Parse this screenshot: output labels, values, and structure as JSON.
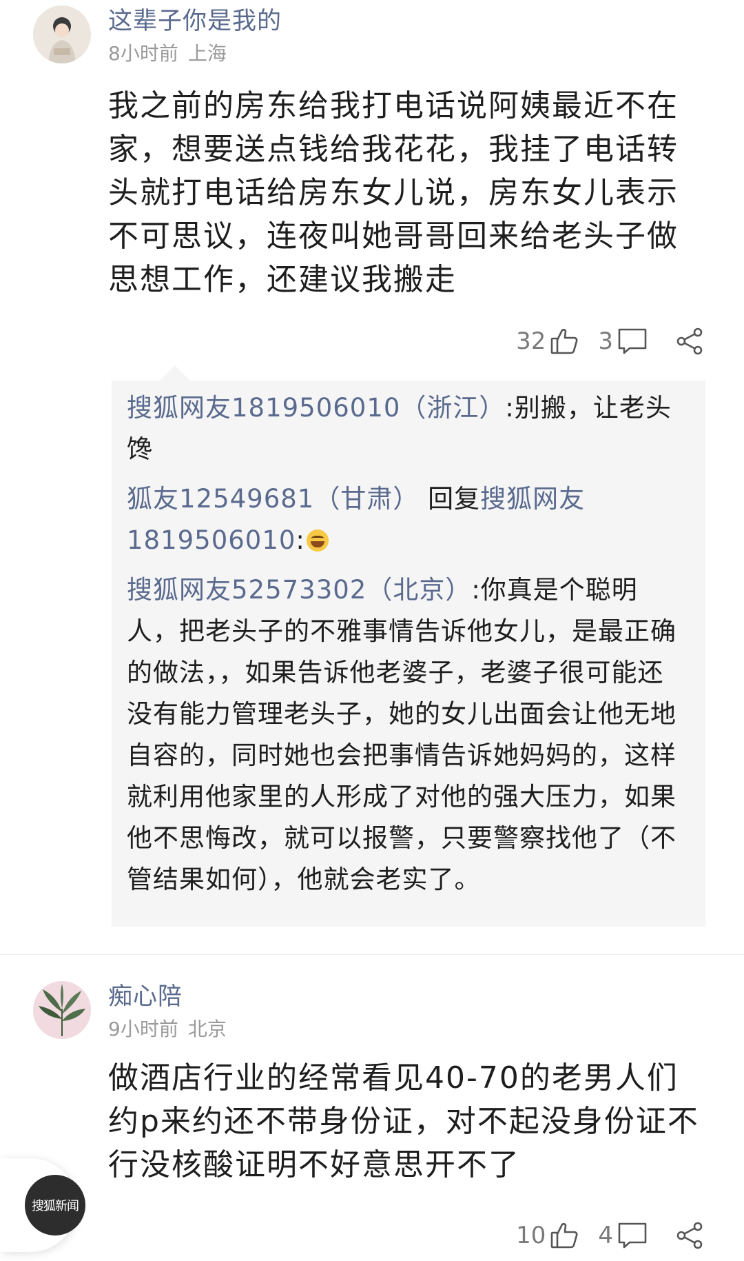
{
  "comments": [
    {
      "username": "这辈子你是我的",
      "time": "8小时前",
      "location": "上海",
      "text": "我之前的房东给我打电话说阿姨最近不在家，想要送点钱给我花花，我挂了电话转头就打电话给房东女儿说，房东女儿表示不可思议，连夜叫她哥哥回来给老头子做思想工作，还建议我搬走",
      "likes": "32",
      "replies_count": "3",
      "avatar_icon": "user-avatar-icon",
      "replies": [
        {
          "author": "搜狐网友1819506010（浙江）",
          "text": ":别搬，让老头馋"
        },
        {
          "author": "狐友12549681（甘肃）",
          "reply_word": "回复",
          "reply_to": "搜狐网友1819506010",
          "text": ":",
          "emoji_icon": "grinning-squint-emoji-icon"
        },
        {
          "author": "搜狐网友52573302（北京）",
          "text": ":你真是个聪明人，把老头子的不雅事情告诉他女儿，是最正确的做法，，如果告诉他老婆子，老婆子很可能还没有能力管理老头子，她的女儿出面会让他无地自容的，同时她也会把事情告诉她妈妈的，这样就利用他家里的人形成了对他的强大压力，如果他不思悔改，就可以报警，只要警察找他了（不管结果如何），他就会老实了。"
        }
      ]
    },
    {
      "username": "痴心陪",
      "time": "9小时前",
      "location": "北京",
      "text": "做酒店行业的经常看见40-70的老男人们约p来约还不带身份证，对不起没身份证不行没核酸证明不好意思开不了",
      "likes": "10",
      "replies_count": "4",
      "avatar_icon": "plant-avatar-icon"
    }
  ],
  "floating_logo": {
    "text": "搜狐新闻",
    "icon": "sohu-news-logo-icon"
  },
  "icons": {
    "like": "thumbs-up-icon",
    "reply": "chat-bubble-icon",
    "share": "share-icon"
  },
  "colors": {
    "username": "#5a6a8e",
    "meta": "#9a9a9a",
    "body": "#1e1e1e",
    "reply_bg": "#f5f5f5",
    "action": "#7a7a7a"
  }
}
